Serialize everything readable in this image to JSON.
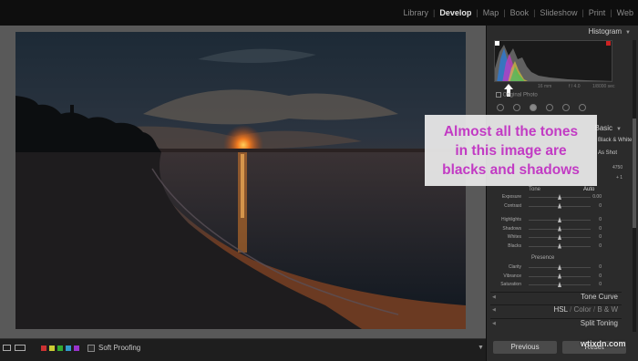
{
  "modules": [
    "Library",
    "Develop",
    "Map",
    "Book",
    "Slideshow",
    "Print",
    "Web"
  ],
  "active_module": "Develop",
  "module_separator": "|",
  "panels": {
    "histogram": "Histogram",
    "basic": "Basic",
    "tone_curve": "Tone Curve",
    "hsl": "HSL",
    "color": "Color",
    "bw": "B & W",
    "split_toning": "Split Toning",
    "slash": "/"
  },
  "histogram_meta": {
    "focal": "16 mm",
    "aperture": "f / 4.0",
    "shutter": "1/8000 sec"
  },
  "original_photo_label": "Original Photo",
  "basic_partial": {
    "color_tab": "Color",
    "bw_tab": "Black & White",
    "wb_preset": "As Shot",
    "temp_value": "4750",
    "tint_value": "+ 1"
  },
  "tone": {
    "label": "Tone",
    "auto": "Auto"
  },
  "tone_sliders": [
    {
      "label": "Exposure",
      "value": "0.00",
      "pos": 0.5
    },
    {
      "label": "Contrast",
      "value": "0",
      "pos": 0.5
    }
  ],
  "detail_sliders": [
    {
      "label": "Highlights",
      "value": "0",
      "pos": 0.5
    },
    {
      "label": "Shadows",
      "value": "0",
      "pos": 0.5
    },
    {
      "label": "Whites",
      "value": "0",
      "pos": 0.5
    },
    {
      "label": "Blacks",
      "value": "0",
      "pos": 0.5
    }
  ],
  "presence": {
    "label": "Presence"
  },
  "presence_sliders": [
    {
      "label": "Clarity",
      "value": "0",
      "pos": 0.5
    },
    {
      "label": "Vibrance",
      "value": "0",
      "pos": 0.5
    },
    {
      "label": "Saturation",
      "value": "0",
      "pos": 0.5
    }
  ],
  "buttons": {
    "previous": "Previous",
    "reset": "Reset"
  },
  "toolbar": {
    "soft_proofing": "Soft Proofing",
    "swatch_colors": [
      "#c33",
      "#cc3",
      "#3a3",
      "#39c",
      "#93c"
    ]
  },
  "callout": {
    "lines": [
      "Almost all the tones",
      "in this image are",
      "blacks and shadows"
    ],
    "color": "#c23bc4"
  },
  "watermark": "wtixdn.com"
}
